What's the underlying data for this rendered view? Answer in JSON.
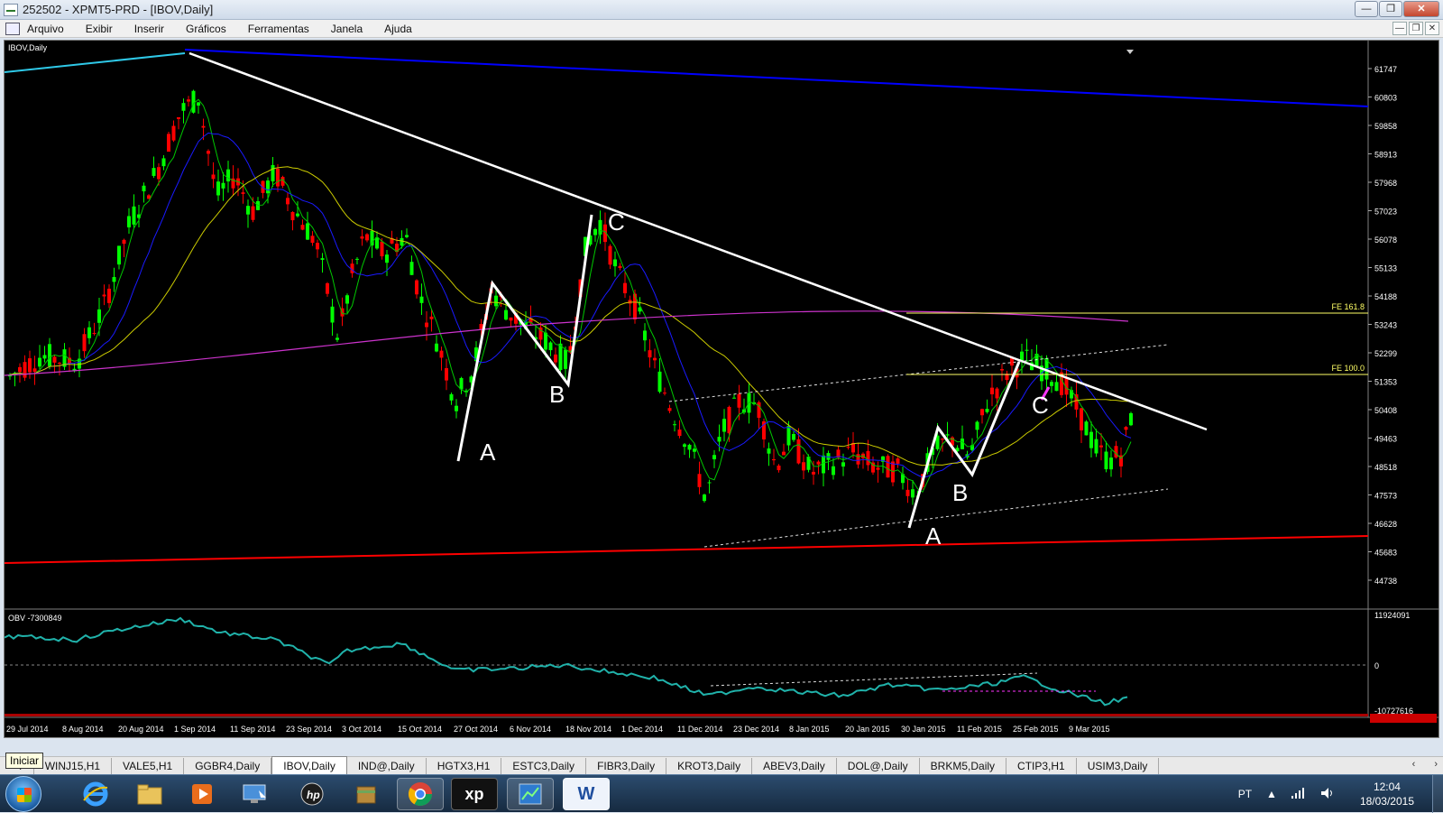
{
  "window": {
    "title": "252502 - XPMT5-PRD - [IBOV,Daily]",
    "min_glyph": "—",
    "restore_glyph": "❐",
    "close_glyph": "✕"
  },
  "menu": [
    "Arquivo",
    "Exibir",
    "Inserir",
    "Gráficos",
    "Ferramentas",
    "Janela",
    "Ajuda"
  ],
  "chart": {
    "symbol_label": "IBOV,Daily",
    "obv_label": "OBV -7300849",
    "price_ticks": [
      "61747",
      "60803",
      "59858",
      "58913",
      "57968",
      "57023",
      "56078",
      "55133",
      "54188",
      "53243",
      "52299",
      "51353",
      "50408",
      "49463",
      "48518",
      "47573",
      "46628",
      "45683",
      "44738"
    ],
    "obv_ticks": [
      "11924091",
      "0",
      "-10727616"
    ],
    "date_ticks": [
      "29 Jul 2014",
      "8 Aug 2014",
      "20 Aug 2014",
      "1 Sep 2014",
      "11 Sep 2014",
      "23 Sep 2014",
      "3 Oct 2014",
      "15 Oct 2014",
      "27 Oct 2014",
      "6 Nov 2014",
      "18 Nov 2014",
      "1 Dec 2014",
      "11 Dec 2014",
      "23 Dec 2014",
      "8 Jan 2015",
      "20 Jan 2015",
      "30 Jan 2015",
      "11 Feb 2015",
      "25 Feb 2015",
      "9 Mar 2015"
    ],
    "fe_labels": [
      "FE 161.8",
      "FE 100.0"
    ],
    "wave_labels": [
      "A",
      "B",
      "C",
      "A",
      "B",
      "C"
    ],
    "colors": {
      "background": "#000000",
      "bull": "#00ff00",
      "bear": "#ff0000",
      "ma_fast": "#00c800",
      "ma_mid": "#1a1aff",
      "ma_slow": "#cccc00",
      "ma_long": "#cc33cc",
      "trendline": "#ffffff",
      "resistance": "#0000ff",
      "support": "#ff0000",
      "obv": "#20b2aa",
      "fibo": "#ffff66"
    }
  },
  "tabs": [
    "4",
    "WINJ15,H1",
    "VALE5,H1",
    "GGBR4,Daily",
    "IBOV,Daily",
    "IND@,Daily",
    "HGTX3,H1",
    "ESTC3,Daily",
    "FIBR3,Daily",
    "KROT3,Daily",
    "ABEV3,Daily",
    "DOL@,Daily",
    "BRKM5,Daily",
    "CTIP3,H1",
    "USIM3,Daily"
  ],
  "active_tab": "IBOV,Daily",
  "tab_arrows": [
    "‹",
    "›"
  ],
  "tooltip": "Iniciar",
  "taskbar": {
    "icons": [
      "windows-start",
      "internet-explorer",
      "file-explorer",
      "media-player",
      "remote-desktop",
      "hp-support",
      "archive-manager",
      "chrome",
      "xp-investimentos",
      "metatrader",
      "word"
    ],
    "xp_text": "xp",
    "word_text": "W",
    "language": "PT",
    "time": "12:04",
    "date": "18/03/2015"
  }
}
